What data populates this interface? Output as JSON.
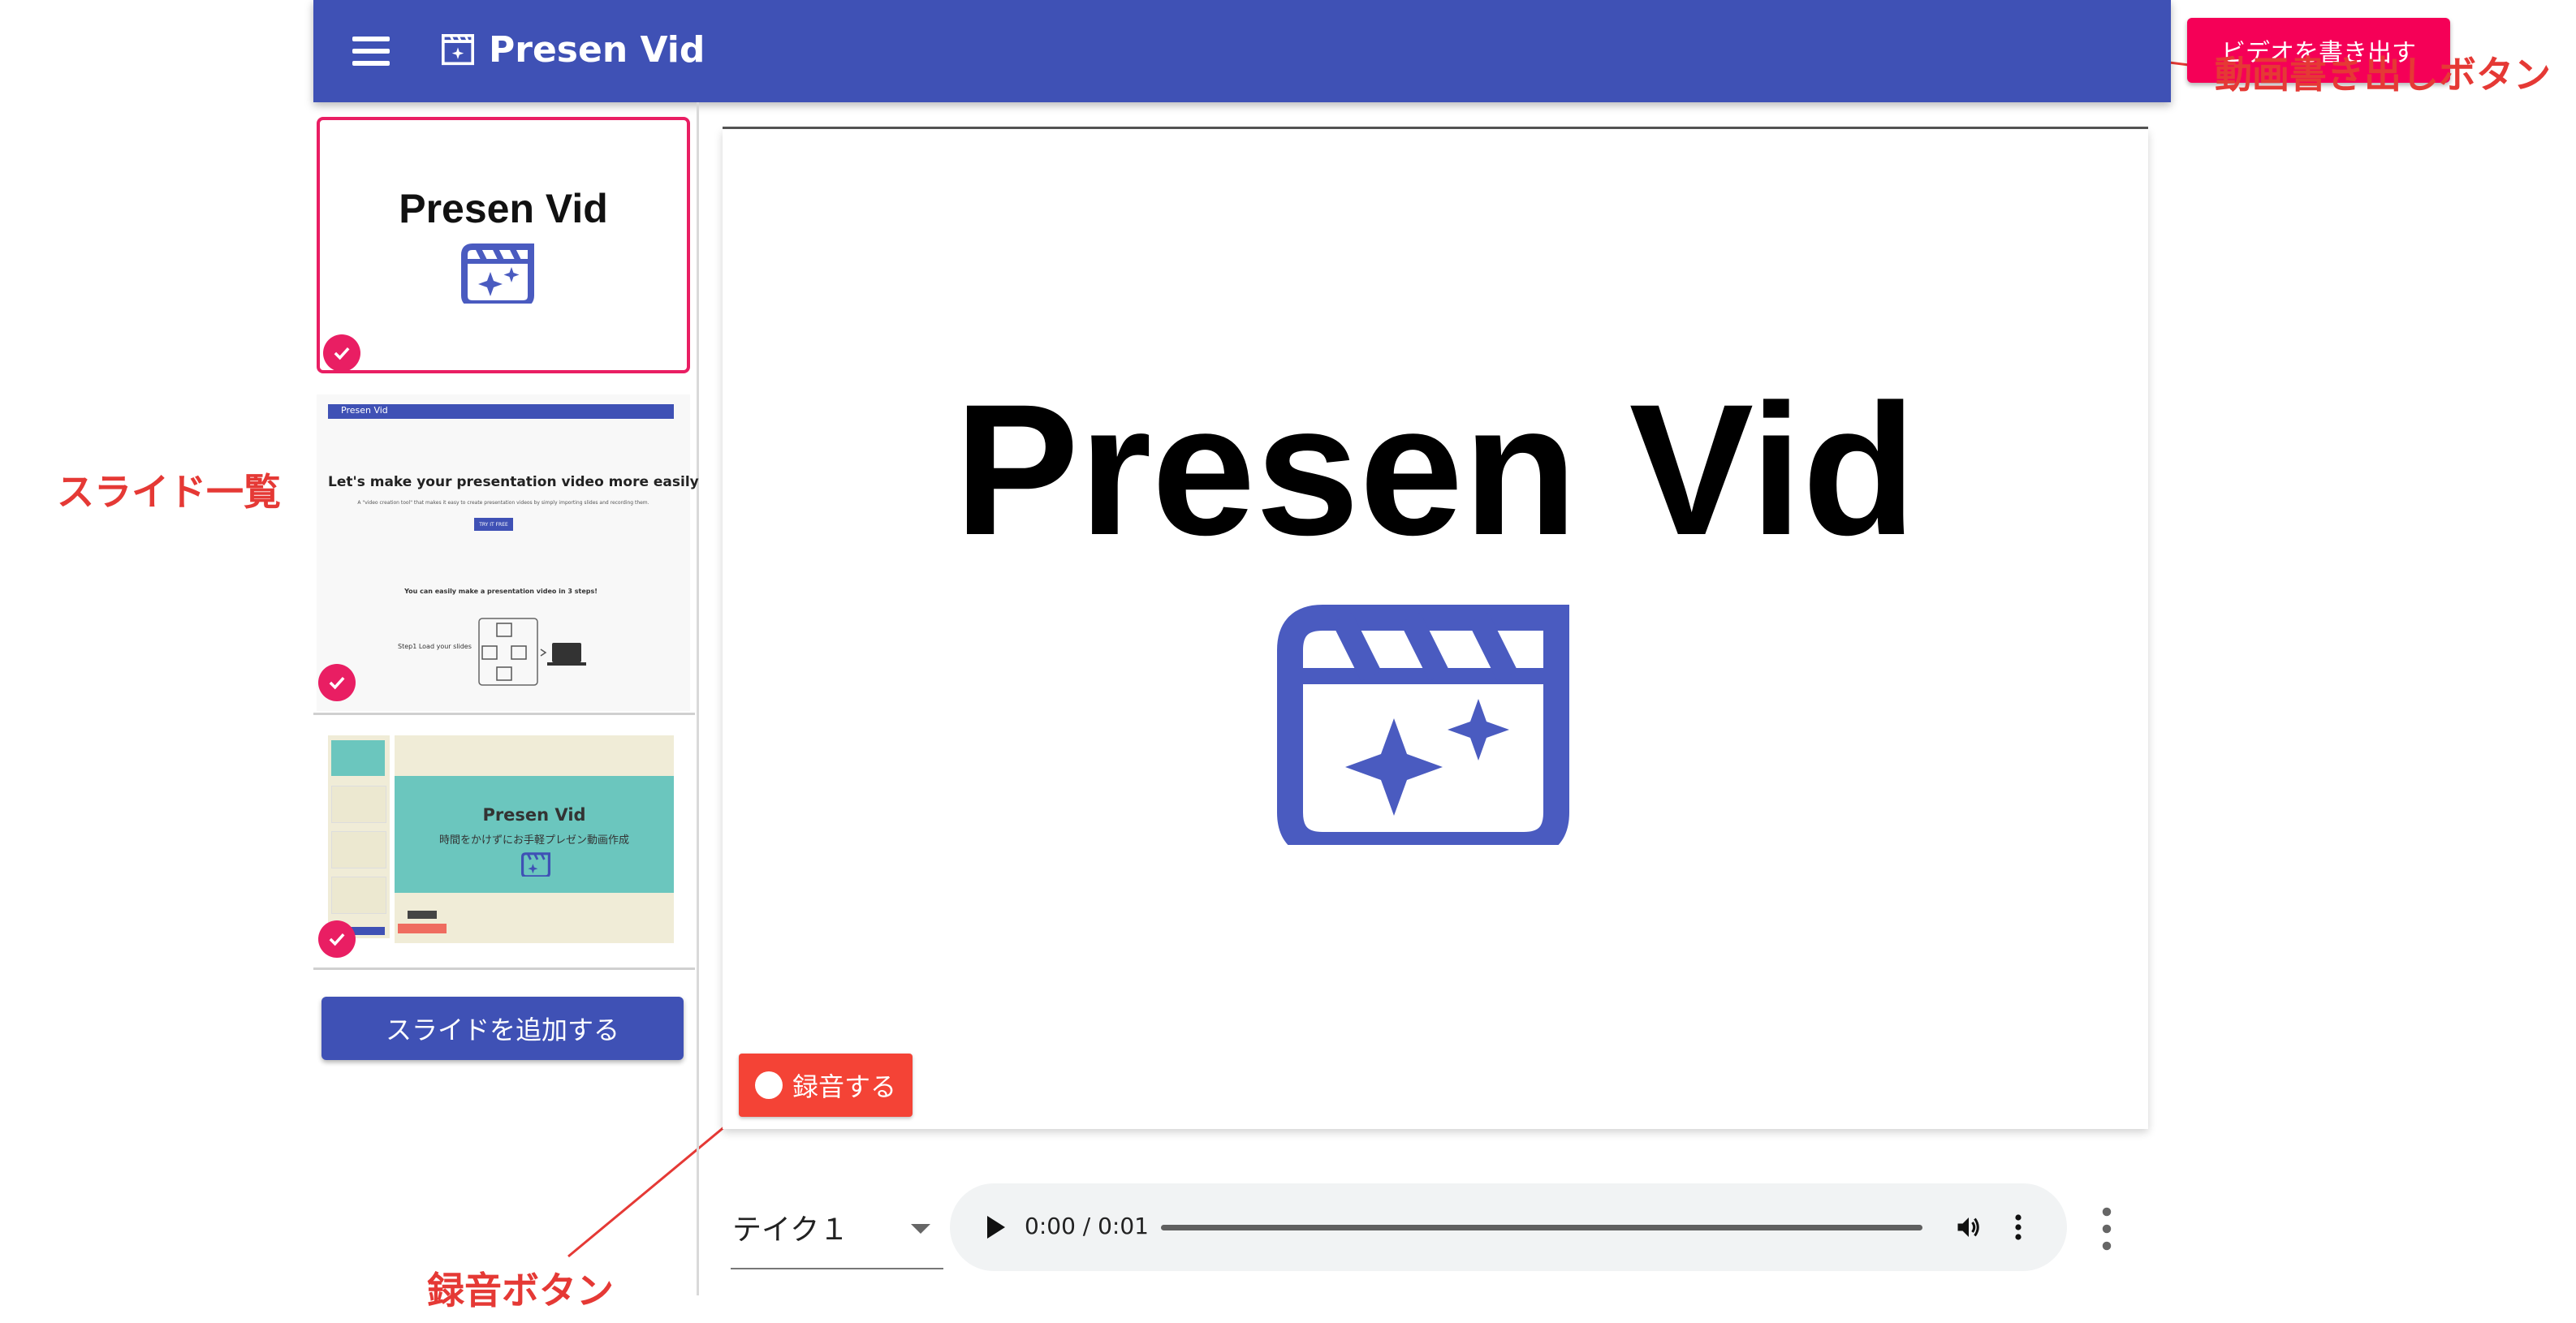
{
  "appbar": {
    "title": "Presen Vid",
    "export_label": "ビデオを書き出す"
  },
  "sidebar": {
    "slides": [
      {
        "title": "Presen Vid",
        "selected": true,
        "checked": true
      },
      {
        "header": "Presen Vid",
        "heading": "Let's make your presentation video more easily",
        "subtext": "A \"video creation tool\" that makes it easy to create presentation videos by simply importing slides and recording them.",
        "cta_label": "TRY IT FREE",
        "steps_heading": "You can easily make a presentation video in 3 steps!",
        "step1_label": "Step1 Load your slides",
        "checked": true
      },
      {
        "title": "Presen Vid",
        "subtitle": "時間をかけずにお手軽プレゼン動画作成",
        "checked": true
      }
    ],
    "add_slide_label": "スライドを追加する"
  },
  "preview": {
    "title": "Presen Vid"
  },
  "recorder": {
    "record_label": "録音する"
  },
  "take": {
    "selected": "テイク１"
  },
  "audio": {
    "time": "0:00 / 0:01",
    "progress": 0
  },
  "colors": {
    "primary": "#3f51b5",
    "accent": "#f50057",
    "record": "#f44336",
    "check": "#e91e63",
    "annotation": "#e53935"
  },
  "annotations": {
    "export_button": "動画書き出しボタン",
    "slide_list": "スライド一覧",
    "record_button": "録音ボタン"
  }
}
